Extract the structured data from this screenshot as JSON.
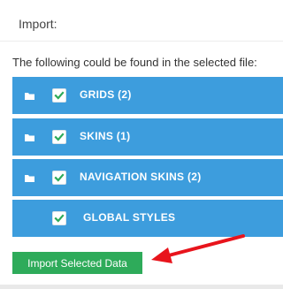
{
  "header": {
    "title": "Import:"
  },
  "intro_text": "The following could be found in the selected file:",
  "items": [
    {
      "label": "GRIDS (2)",
      "icon": "folder-icon",
      "checked": true
    },
    {
      "label": "SKINS (1)",
      "icon": "folder-icon",
      "checked": true
    },
    {
      "label": "NAVIGATION SKINS (2)",
      "icon": "folder-icon",
      "checked": true
    },
    {
      "label": "GLOBAL STYLES",
      "icon": null,
      "checked": true
    }
  ],
  "import_button_label": "Import Selected Data",
  "colors": {
    "row_background": "#3d9ddd",
    "button_background": "#2eab5a",
    "checkmark": "#2eab5a",
    "arrow": "#e8141c"
  }
}
